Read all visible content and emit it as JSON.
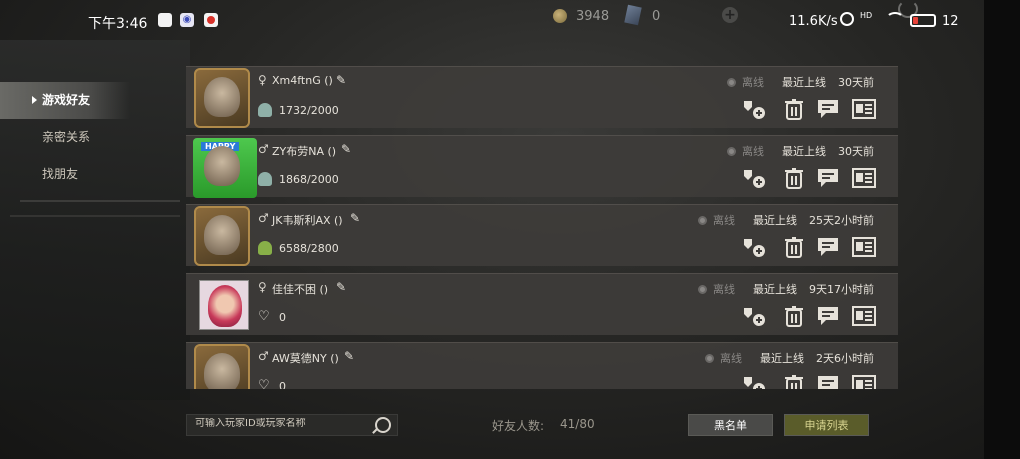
{
  "status_bar": {
    "time": "下午3:46",
    "coins": "3948",
    "cards": "0",
    "network_speed": "11.6K/s",
    "hd_label": "HD",
    "battery": "12"
  },
  "sidebar": {
    "items": [
      {
        "label": "游戏好友",
        "active": true
      },
      {
        "label": "亲密关系",
        "active": false
      },
      {
        "label": "找朋友",
        "active": false
      }
    ]
  },
  "friends": [
    {
      "gender": "♀",
      "name": "Xm4ftnG ()",
      "stat_icon": "people-icon",
      "stat": "1732/2000",
      "status": "离线",
      "last_label": "最近上线",
      "last_seen": "30天前"
    },
    {
      "gender": "♂",
      "name": "ZY布劳NA ()",
      "stat_icon": "people-icon",
      "stat": "1868/2000",
      "status": "离线",
      "last_label": "最近上线",
      "last_seen": "30天前"
    },
    {
      "gender": "♂",
      "name": "JK韦斯利AX ()",
      "stat_icon": "green-people-icon",
      "stat": "6588/2800",
      "status": "离线",
      "last_label": "最近上线",
      "last_seen": "25天2小时前"
    },
    {
      "gender": "♀",
      "name": "佳佳不困 ()",
      "stat_icon": "heart-icon",
      "stat": "0",
      "status": "离线",
      "last_label": "最近上线",
      "last_seen": "9天17小时前"
    },
    {
      "gender": "♂",
      "name": "AW莫德NY ()",
      "stat_icon": "heart-icon",
      "stat": "0",
      "status": "离线",
      "last_label": "最近上线",
      "last_seen": "2天6小时前"
    }
  ],
  "search": {
    "placeholder": "可输入玩家ID或玩家名称"
  },
  "footer": {
    "friend_count_label": "好友人数:",
    "friend_count": "41/80",
    "blacklist_label": "黑名单",
    "apply_list_label": "申请列表"
  },
  "colors": {
    "accent": "#5a5c2a",
    "panel": "#3e3c3a",
    "offline": "#8a8886"
  }
}
